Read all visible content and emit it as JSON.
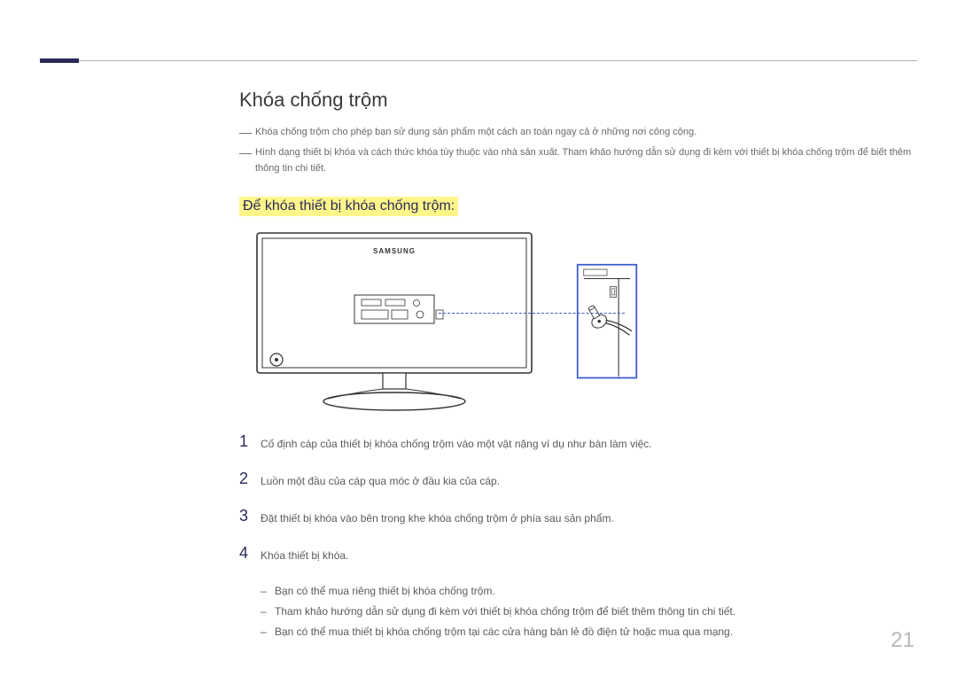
{
  "section": {
    "title": "Khóa chống trộm",
    "notes": [
      "Khóa chống trộm cho phép bạn sử dụng sản phẩm một cách an toàn ngay cả ở những nơi công cộng.",
      "Hình dạng thiết bị khóa và cách thức khóa tùy thuộc vào nhà sản xuất. Tham khảo hướng dẫn sử dụng đi kèm với thiết bị khóa chống trộm để biết thêm thông tin chi tiết."
    ],
    "subsection_title": "Để khóa thiết bị khóa chống trộm:",
    "monitor_brand": "SAMSUNG",
    "steps": [
      {
        "num": "1",
        "text": "Cố định cáp của thiết bị khóa chống trộm vào một vật nặng ví dụ như bàn làm việc."
      },
      {
        "num": "2",
        "text": "Luồn một đầu của cáp qua móc ở đầu kia của cáp."
      },
      {
        "num": "3",
        "text": "Đặt thiết bị khóa vào bên trong khe khóa chống trộm ở phía sau sản phẩm."
      },
      {
        "num": "4",
        "text": "Khóa thiết bị khóa."
      }
    ],
    "bullets": [
      "Bạn có thể mua riêng thiết bị khóa chống trộm.",
      "Tham khảo hướng dẫn sử dụng đi kèm với thiết bị khóa chống trộm để biết thêm thông tin chi tiết.",
      "Bạn có thể mua thiết bị khóa chống trộm tại các cửa hàng bán lẻ đồ điện tử hoặc mua qua mạng."
    ]
  },
  "page_number": "21"
}
